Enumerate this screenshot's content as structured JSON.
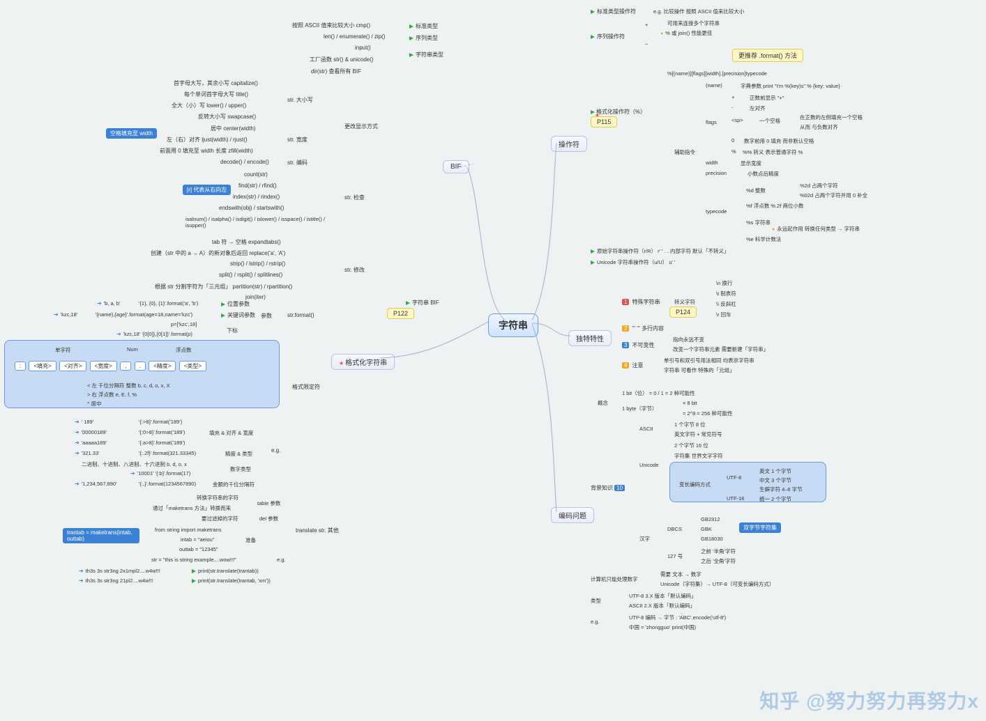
{
  "root": "字符串",
  "left_main": {
    "bif": "BIF",
    "fmtstr": "格式化字符串"
  },
  "right_main": {
    "operators": "操作符",
    "unique": "独特特性",
    "encoding": "编码问题"
  },
  "yellow_tags": {
    "p115": "P115",
    "p122": "P122",
    "p124": "P124"
  },
  "blue_tags": {
    "space_pad": "空格填充至 width",
    "r_from_end": "[r] 代表从右向左",
    "trantab": "trantab = maketrans(intab, outtab)",
    "dbcs": "双字节字符集",
    "bg_badge": "10"
  },
  "bif_rows": {
    "cmp": "按照 ASCII 值来比较大小        cmp()",
    "cmp_type": "标准类型",
    "len": "len() / enumerate() / zip()",
    "len_type": "序列类型",
    "input": "input()",
    "factory": "工厂函数        str() & unicode()",
    "str_type": "字符串类型",
    "dir": "dir(str)        查看所有 BIF"
  },
  "str_methods": {
    "cap": "首字母大写，其余小写        capitalize()",
    "title": "每个单词首字母大写        title()",
    "case": "全大（小）写        lower() / upper()",
    "swap": "反转大小写        swapcase()",
    "cat_case": "str.        大小写",
    "center": "居中        center(width)",
    "just": "左（右）对齐        ljust(width) / rjust()",
    "zfill": "前面用 0 填充至 width 长度        zfill(width)",
    "cat_width": "str.        宽度",
    "change_display": "更改显示方式",
    "codec": "decode() / encode()",
    "cat_codec": "str.        编码",
    "count": "count(str)",
    "find": "find(str) / rfind()",
    "index": "index(str) / rindex()",
    "ends": "endswith(obj) / startswith()",
    "cat_search": "str.        检查",
    "isx": "isalnum() / isalpha() / isdigit() / islower() / isspace() / istitle() / isupper()",
    "expand": "tab 符 → 空格        expandtabs()",
    "replace": "创建（str 中的 a → A）的新对象后返回        replace('a', 'A')",
    "strip": "strip() / lstrip() / rstrip()",
    "split": "split() / rsplit() / splitlines()",
    "part": "根据 str 分割字符为「三元组」        partition(str) / rpartition()",
    "join": "join(iter)",
    "cat_mod": "str.        修改"
  },
  "strformat": {
    "str_bif": "字符串 BIF",
    "title": "str.format()",
    "ex1a": "'b, a, b'",
    "ex1b": "'{1}, {0}, {1}'.format('a', 'b')",
    "ex1t": "位置参数",
    "ex2a": "'kzc,18'",
    "ex2b": "'{name},{age}'.format(age=18,name='kzc')",
    "ex2t": "关键词参数",
    "ex3a": "p=['kzc',18]",
    "ex3b": "'kzc,18'        '{0[0]},{0[1]}'.format(p)",
    "ex3t": "下标",
    "params": "参数"
  },
  "fmt_limit": {
    "title": "格式限定符",
    "h_single": "单字符",
    "h_num": "Num",
    "h_float": "浮点数",
    "row_pill": [
      ":",
      "<填充>",
      "<对齐>",
      "<宽度>",
      ",",
      ".",
      "<精度>",
      "<类型>"
    ],
    "row_align": "<        左          千位分隔符          整数        b, c, d, o, x, X",
    "row_align2": ">        右                                              浮点数   e, E, f, %",
    "row_align3": "^    居中",
    "eg1a": "'   189'",
    "eg1b": "'{:>8}'.format('189')",
    "eg2a": "'00000189'",
    "eg2b": "'{:0>8}'.format('189')",
    "eg2t": "填充 & 对齐 & 宽度",
    "eg3a": "'aaaaa189'",
    "eg3b": "'{:a>8}'.format('189')",
    "eg4a": "'321.33'",
    "eg4b": "'{:.2f}'.format(321.33345)",
    "eg4t": "精度 & 类型",
    "eg5a": "二进制、十进制、八进制、十六进制        b, d, o, x",
    "eg5t": "数字类型",
    "eg5c": "'10001'     '{:b}'.format(17)",
    "eg6a": "'1,234,567,890'",
    "eg6b": "'{:,}'.format(1234567890)",
    "eg6t": "金额的千位分隔符",
    "eg_group": "e.g."
  },
  "translate": {
    "top1": "转换字符串的字符",
    "top2": "通过「maketrans 方法」转换而来",
    "top2r": "table 参数",
    "top3": "要过滤掉的字符",
    "top3r": "del 参数",
    "name": "translate        str.        其他",
    "p1": "from string import maketrans",
    "p2": "intab = \"aeiou\"",
    "p3": "outtab = \"12345\"",
    "p_prep": "准备",
    "s1": "str = \"this is string example....wow!!!\"",
    "s_eg": "e.g.",
    "r1": "th3s 3s str3ng 2x1mpl2....w4w!!!",
    "r1b": "print(str.translate(trantab))",
    "r2": "th3s 3s str3ng 21pl2....w4w!!!",
    "r2b": "print(str.translate(trantab, 'xm'))"
  },
  "ops": {
    "std": "标准类型操作符",
    "std_eg": "e.g.        比较操作        按照 ASCII 值来比较大小",
    "seq": "序列操作符",
    "plus": "+",
    "plus_r": "可用来连接多个字符串",
    "plus_r2": "% 或 join() 性能更佳",
    "minus": "−",
    "fmt_recommend": "更推荐 .format() 方法",
    "fmt_op": "格式化操作符（%）",
    "fmt_spec": "%[(name)][flags][width].[precision]typecode",
    "name": "(name)",
    "name_r": "字典参数        print \"I'm %(key)s\" % {key: value}",
    "flags": "flags",
    "f1": "+",
    "f1r": "正数前显示 \"+\"",
    "f2": "-",
    "f2r": "左对齐",
    "f3": "<sp>",
    "f3r": "一个空格",
    "f3r2": "在正数的左侧填充一个空格",
    "f3r3": "从而        与负数对齐",
    "f4": "0",
    "f4r": "数字前用 0 填充        而非默认空格",
    "f5": "%",
    "f5r": "%%        转义        表示普通字符 %",
    "width": "width",
    "width_r": "显示宽度",
    "prec": "precision",
    "prec_r": "小数点后精度",
    "tc": "typecode",
    "tc_d": "%d        整数",
    "tc_d1": "%2d        占两个字符",
    "tc_d2": "%02d        占两个字符并用 0 补全",
    "tc_f": "%f        浮点数        %.2f        两位小数",
    "tc_s": "%s        字符串",
    "tc_s1": "永远起作用        转换任何类型 → 字符串",
    "tc_e": "%e        科学计数法",
    "aux": "辅助指令",
    "raw": "原始字符串操作符（r/R）        r' '    . .    内部字符        默认「不转义」",
    "uni": "Unicode 字符串操作符（u/U）        u' '"
  },
  "unique": {
    "s1": "特殊字符串",
    "s1n": "1",
    "esc": "转义字符",
    "e1": "\\n        换行",
    "e2": "\\t        制表符",
    "e3": "\\\\        反斜杠",
    "e4": "\\r        回车",
    "s2": "''' '''        多行内容",
    "s2n": "2",
    "s3": "不可变性",
    "s3n": "3",
    "s3a": "指向永远不变",
    "s3b": "改变一个字符串元素        需要新建「字符串」",
    "s4": "注意",
    "s4n": "4",
    "s4a": "单引号和双引号用法相同        均表示字符串",
    "s4b": "字符串        可看作        特殊的「元组」"
  },
  "enc": {
    "bg": "背景知识",
    "concept": "概念",
    "bit": "1 bit（位）        = 0 / 1 = 2 种可能性",
    "byte": "1 byte（字节）",
    "byte1": "= 8 bit",
    "byte2": "= 2^8 = 256 种可能性",
    "ascii": "ASCII",
    "ascii1": "1 个字节        8 位",
    "ascii2": "英文字符 + 常见符号",
    "unicode": "Unicode",
    "uni1": "2 个字节        16 位",
    "uni2": "字符集        世界文字字符",
    "varlen": "变长编码方式",
    "utf8": "UTF-8",
    "utf8a": "英文        1 个字节",
    "utf8b": "中文        3 个字节",
    "utf8c": "生僻字符        4–6 字节",
    "utf16": "UTF-16",
    "utf16a": "统一        2 个字节",
    "hanzi": "汉字",
    "dbcs": "DBCS",
    "dbcs1": "GB2312",
    "dbcs2": "GBK",
    "dbcs3": "GB18030",
    "h127": "127 号",
    "h127a": "之前        '半角'字符",
    "h127b": "之后        '全角'字符",
    "compute": "计算机只能处理数字",
    "comp1": "需要        文本 → 数字",
    "comp2": "Unicode（字符集）→ UTF-8（可变长编码方式）",
    "type": "类型",
    "t_utf8": "UTF-8        3.X 版本「默认编码」",
    "t_ascii": "ASCII        2.X 版本「默认编码」",
    "eg": "e.g.",
    "eg1": "UTF-8 编码 → 字节 :  'ABC'.encode('utf-8')",
    "eg2": "中国 = 'zhongguo'        print(中国)"
  },
  "watermark": "知乎 @努力努力再努力x"
}
